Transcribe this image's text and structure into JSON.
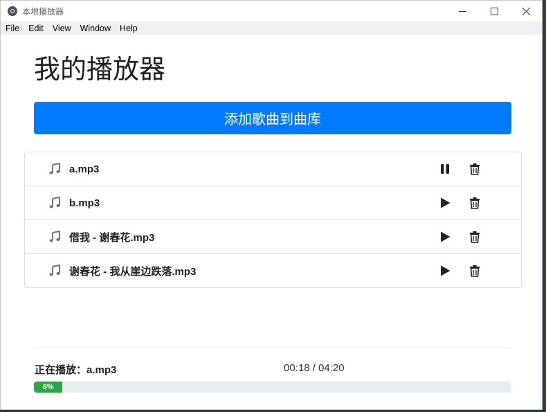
{
  "window": {
    "title": "本地播放器",
    "controls": {
      "minimize": "—",
      "maximize": "☐",
      "close": "✕"
    }
  },
  "menu": [
    "File",
    "Edit",
    "View",
    "Window",
    "Help"
  ],
  "header": {
    "title": "我的播放器"
  },
  "add_button": {
    "label": "添加歌曲到曲库",
    "color": "#007bff"
  },
  "songs": [
    {
      "name": "a.mp3",
      "state": "pause-icon"
    },
    {
      "name": "b.mp3",
      "state": "play-icon"
    },
    {
      "name": "借我 - 谢春花.mp3",
      "state": "play-icon"
    },
    {
      "name": "谢春花 - 我从崖边跌落.mp3",
      "state": "play-icon"
    }
  ],
  "player": {
    "now_playing_label": "正在播放：a.mp3",
    "time": "00:18 / 04:20",
    "progress_percent": 6,
    "progress_label": "6%",
    "progress_color": "#28a745"
  }
}
